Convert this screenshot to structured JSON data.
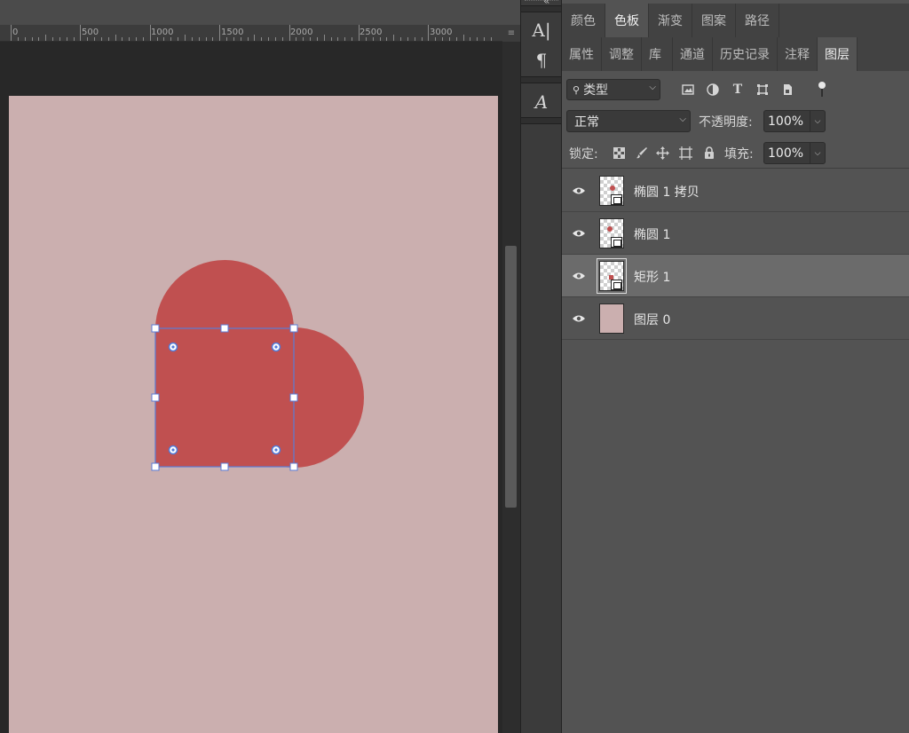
{
  "ruler": {
    "labels": [
      "0",
      "500",
      "1000",
      "1500",
      "2000",
      "2500",
      "3000"
    ],
    "corner_symbol": "≡"
  },
  "canvas": {
    "document_color": "#cbafaf",
    "shape_color": "#c05050",
    "selection_color": "#5b7bd6"
  },
  "tools": {
    "character_label": "A|",
    "paragraph_label": "¶",
    "glyphs_label": "A"
  },
  "panel_tabs_top": [
    {
      "label": "颜色",
      "active": false
    },
    {
      "label": "色板",
      "active": true
    },
    {
      "label": "渐变",
      "active": false
    },
    {
      "label": "图案",
      "active": false
    },
    {
      "label": "路径",
      "active": false
    }
  ],
  "panel_tabs_bottom": [
    {
      "label": "属性",
      "active": false
    },
    {
      "label": "调整",
      "active": false
    },
    {
      "label": "库",
      "active": false
    },
    {
      "label": "通道",
      "active": false
    },
    {
      "label": "历史记录",
      "active": false
    },
    {
      "label": "注释",
      "active": false
    },
    {
      "label": "图层",
      "active": true
    }
  ],
  "layers_panel": {
    "filter_kind_label": "类型",
    "blend_mode": "正常",
    "opacity_label": "不透明度:",
    "opacity_value": "100%",
    "lock_label": "锁定:",
    "fill_label": "填充:",
    "fill_value": "100%",
    "layers": [
      {
        "name": "椭圆 1 拷贝",
        "type": "shape",
        "selected": false,
        "visible": true
      },
      {
        "name": "椭圆 1",
        "type": "shape",
        "selected": false,
        "visible": true
      },
      {
        "name": "矩形 1",
        "type": "shape",
        "selected": true,
        "visible": true
      },
      {
        "name": "图层 0",
        "type": "pixel",
        "selected": false,
        "visible": true
      }
    ]
  }
}
